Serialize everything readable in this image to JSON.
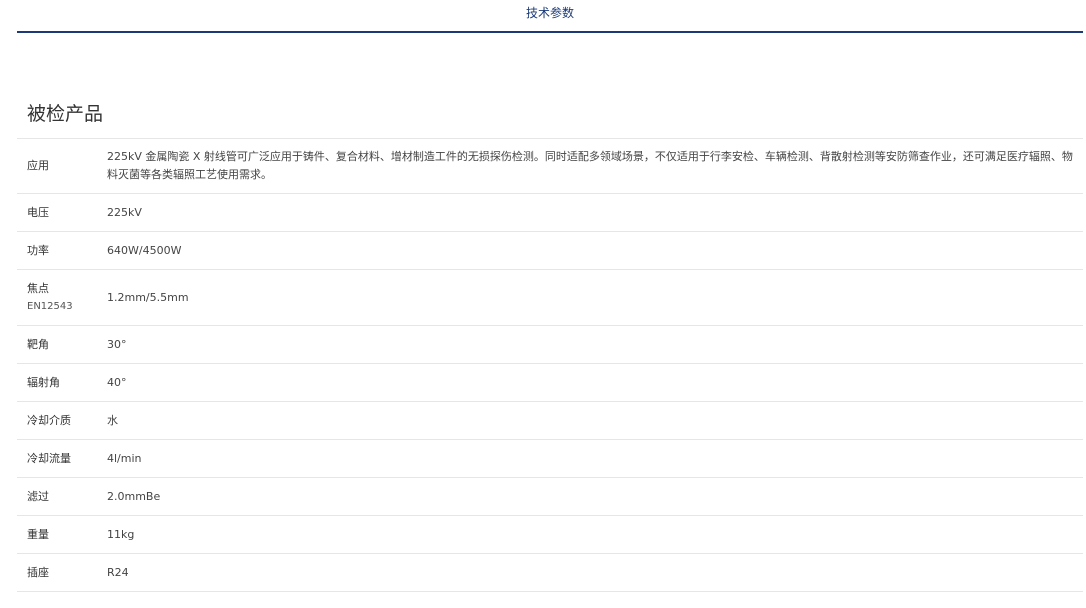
{
  "tabs": [
    {
      "label": "技术参数",
      "active": true
    }
  ],
  "colors": {
    "accent": "#1b3a77",
    "divider": "#e6e6e6",
    "text": "#333333"
  },
  "section": {
    "title": "被检产品"
  },
  "specs": [
    {
      "label": "应用",
      "value": "225kV 金属陶瓷 X 射线管可广泛应用于铸件、复合材料、增材制造工件的无损探伤检测。同时适配多领域场景，不仅适用于行李安检、车辆检测、背散射检测等安防筛查作业，还可满足医疗辐照、物料灭菌等各类辐照工艺使用需求。"
    },
    {
      "label": "电压",
      "value": "225kV"
    },
    {
      "label": "功率",
      "value": "640W/4500W"
    },
    {
      "label": "焦点",
      "sublabel": "EN12543",
      "value": "1.2mm/5.5mm"
    },
    {
      "label": "靶角",
      "value": "30°"
    },
    {
      "label": "辐射角",
      "value": "40°"
    },
    {
      "label": "冷却介质",
      "value": "水"
    },
    {
      "label": "冷却流量",
      "value": "4l/min"
    },
    {
      "label": "滤过",
      "value": "2.0mmBe"
    },
    {
      "label": "重量",
      "value": "11kg"
    },
    {
      "label": "插座",
      "value": "R24"
    }
  ]
}
